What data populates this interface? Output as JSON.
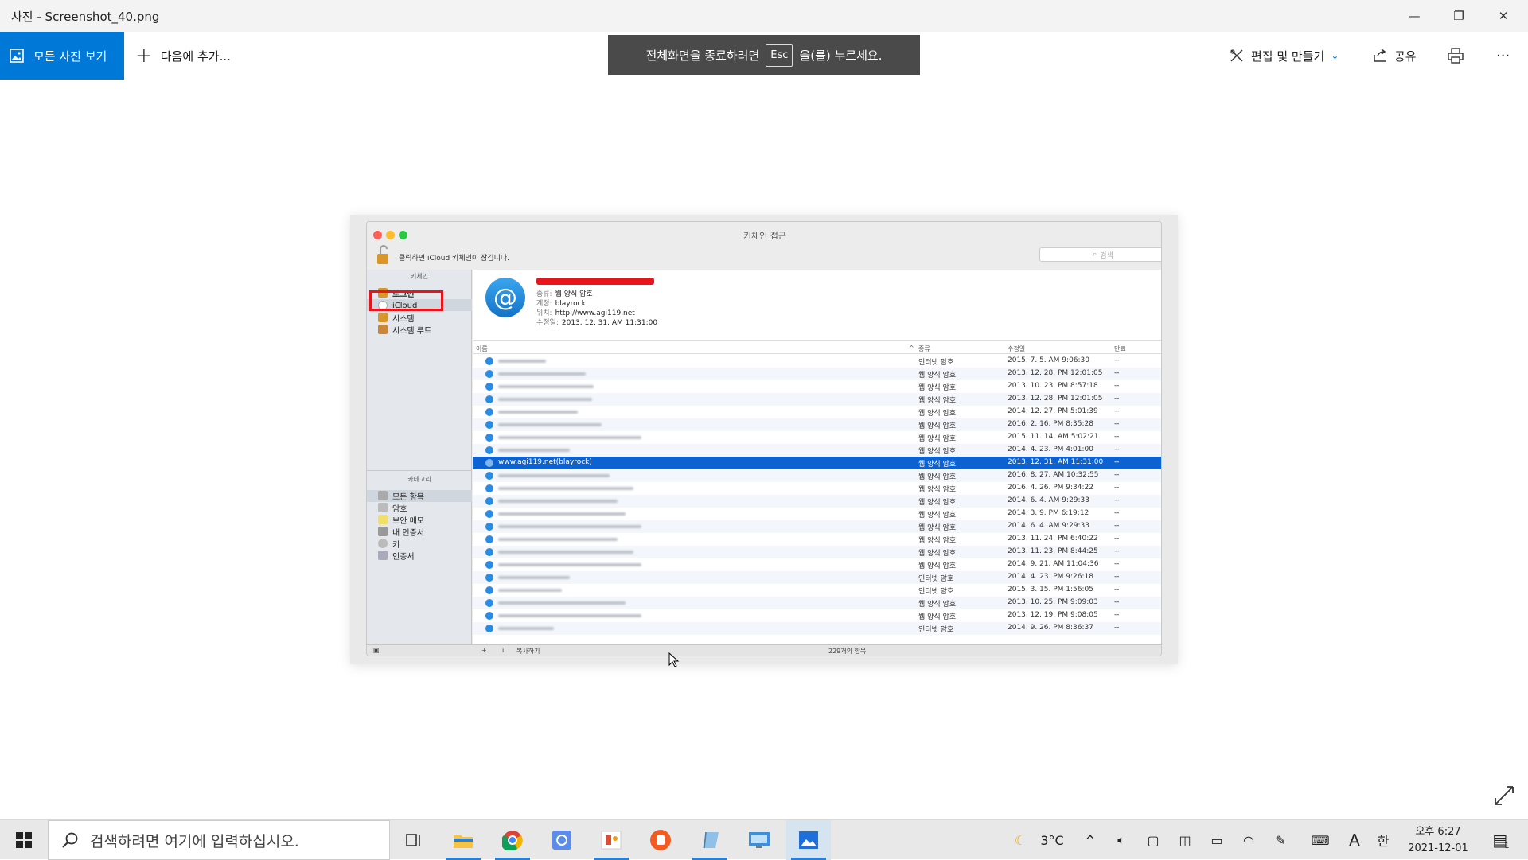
{
  "window": {
    "title": "사진 - Screenshot_40.png",
    "minimize": "—",
    "restore": "❐",
    "close": "✕"
  },
  "toolbar": {
    "all_photos": "모든 사진 보기",
    "add_to": "다음에 추가...",
    "banner_before": "전체화면을 종료하려면",
    "banner_key": "Esc",
    "banner_after": "을(를) 누르세요.",
    "edit_create": "편집 및 만들기",
    "share": "공유",
    "more": "···"
  },
  "keychain": {
    "title": "키체인 접근",
    "lock_message": "클릭하면 iCloud 키체인이 잠깁니다.",
    "search_placeholder": "검색",
    "keychains_header": "키체인",
    "keychains": [
      "로그인",
      "iCloud",
      "시스템",
      "시스템 루트"
    ],
    "category_header": "카테고리",
    "categories": [
      "모든 항목",
      "암호",
      "보안 메모",
      "내 인증서",
      "키",
      "인증서"
    ],
    "detail": {
      "kind_label": "종류:",
      "kind": "웹 양식 암호",
      "account_label": "계정:",
      "account": "blayrock",
      "where_label": "위치:",
      "where": "http://www.agi119.net",
      "modified_label": "수정일:",
      "modified": "2013. 12. 31. AM 11:31:00"
    },
    "columns": {
      "name": "이름",
      "kind": "종류",
      "modified": "수정일",
      "expires": "만료"
    },
    "selected_name": "www.agi119.net(blayrock)",
    "rows": [
      {
        "kind": "인터넷 암호",
        "date": "2015. 7. 5. AM 9:06:30",
        "exp": "--",
        "w": 60
      },
      {
        "kind": "웹 양식 암호",
        "date": "2013. 12. 28. PM 12:01:05",
        "exp": "--",
        "w": 110
      },
      {
        "kind": "웹 양식 암호",
        "date": "2013. 10. 23. PM 8:57:18",
        "exp": "--",
        "w": 120
      },
      {
        "kind": "웹 양식 암호",
        "date": "2013. 12. 28. PM 12:01:05",
        "exp": "--",
        "w": 118
      },
      {
        "kind": "웹 양식 암호",
        "date": "2014. 12. 27. PM 5:01:39",
        "exp": "--",
        "w": 100
      },
      {
        "kind": "웹 양식 암호",
        "date": "2016. 2. 16. PM 8:35:28",
        "exp": "--",
        "w": 130
      },
      {
        "kind": "웹 양식 암호",
        "date": "2015. 11. 14. AM 5:02:21",
        "exp": "--",
        "w": 180
      },
      {
        "kind": "웹 양식 암호",
        "date": "2014. 4. 23. PM 4:01:00",
        "exp": "--",
        "w": 90
      },
      {
        "kind": "웹 양식 암호",
        "date": "2013. 12. 31. AM 11:31:00",
        "exp": "--",
        "sel": true
      },
      {
        "kind": "웹 양식 암호",
        "date": "2016. 8. 27. AM 10:32:55",
        "exp": "--",
        "w": 140
      },
      {
        "kind": "웹 양식 암호",
        "date": "2016. 4. 26. PM 9:34:22",
        "exp": "--",
        "w": 170
      },
      {
        "kind": "웹 양식 암호",
        "date": "2014. 6. 4. AM 9:29:33",
        "exp": "--",
        "w": 150
      },
      {
        "kind": "웹 양식 암호",
        "date": "2014. 3. 9. PM 6:19:12",
        "exp": "--",
        "w": 160
      },
      {
        "kind": "웹 양식 암호",
        "date": "2014. 6. 4. AM 9:29:33",
        "exp": "--",
        "w": 180
      },
      {
        "kind": "웹 양식 암호",
        "date": "2013. 11. 24. PM 6:40:22",
        "exp": "--",
        "w": 150
      },
      {
        "kind": "웹 양식 암호",
        "date": "2013. 11. 23. PM 8:44:25",
        "exp": "--",
        "w": 170
      },
      {
        "kind": "웹 양식 암호",
        "date": "2014. 9. 21. AM 11:04:36",
        "exp": "--",
        "w": 180
      },
      {
        "kind": "인터넷 암호",
        "date": "2014. 4. 23. PM 9:26:18",
        "exp": "--",
        "w": 90
      },
      {
        "kind": "인터넷 암호",
        "date": "2015. 3. 15. PM 1:56:05",
        "exp": "--",
        "w": 80
      },
      {
        "kind": "웹 양식 암호",
        "date": "2013. 10. 25. PM 9:09:03",
        "exp": "--",
        "w": 160
      },
      {
        "kind": "웹 양식 암호",
        "date": "2013. 12. 19. PM 9:08:05",
        "exp": "--",
        "w": 180
      },
      {
        "kind": "인터넷 암호",
        "date": "2014. 9. 26. PM 8:36:37",
        "exp": "--",
        "w": 70
      }
    ],
    "footer_copy": "복사하기",
    "footer_count": "229개의 항목"
  },
  "taskbar": {
    "search_placeholder": "검색하려면 여기에 입력하십시오.",
    "weather": "3°C",
    "ime_a": "A",
    "ime_han": "한",
    "time": "오후 6:27",
    "date": "2021-12-01",
    "notif_count": "1"
  },
  "colors": {
    "accent": "#0078d7",
    "selection": "#0d62d1",
    "highlight_box": "#e8141c"
  }
}
